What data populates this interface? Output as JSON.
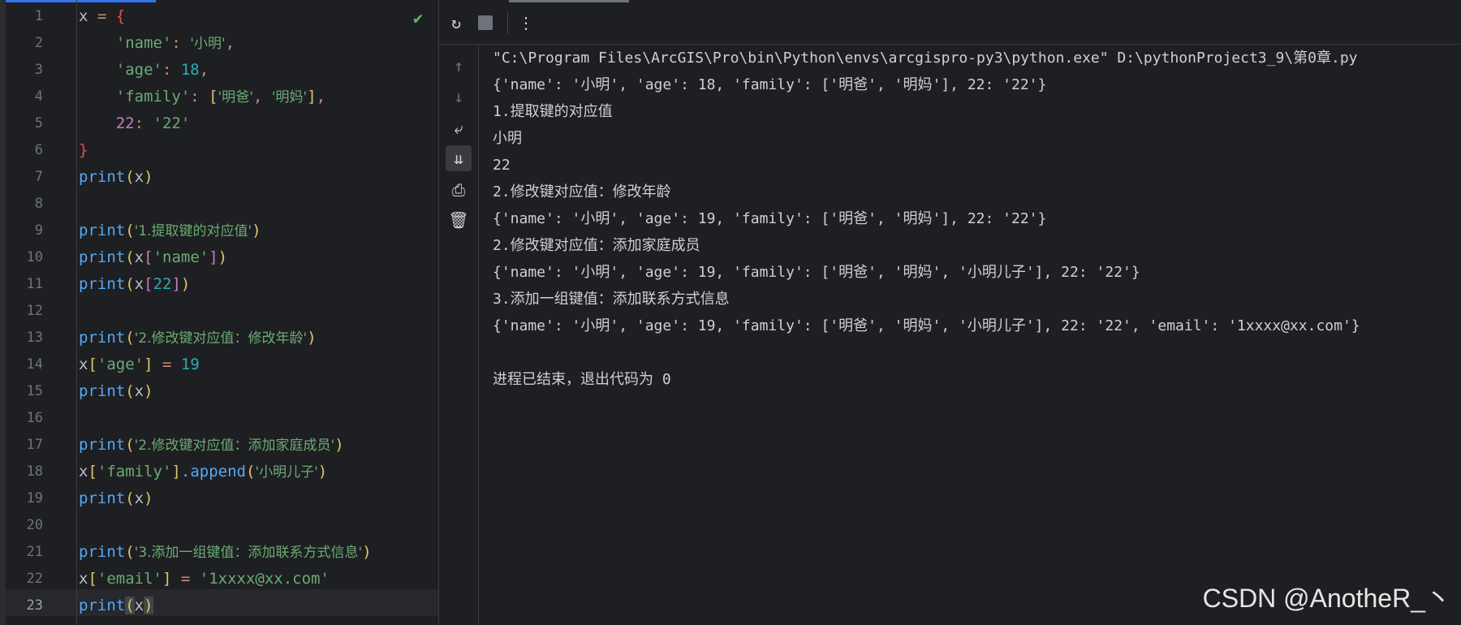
{
  "editor": {
    "line_numbers": [
      "1",
      "2",
      "3",
      "4",
      "5",
      "6",
      "7",
      "8",
      "9",
      "10",
      "11",
      "12",
      "13",
      "14",
      "15",
      "16",
      "17",
      "18",
      "19",
      "20",
      "21",
      "22",
      "23"
    ],
    "inspection_icon": "check-icon",
    "code": {
      "l1_var": "x",
      "l1_eq": " = ",
      "l1_brace": "{",
      "l2_key": "'name'",
      "l2_colon": ": ",
      "l2_val": "'小明'",
      "l2_comma": ",",
      "l3_key": "'age'",
      "l3_colon": ": ",
      "l3_val": "18",
      "l3_comma": ",",
      "l4_key": "'family'",
      "l4_colon": ": ",
      "l4_open": "[",
      "l4_v1": "'明爸'",
      "l4_sep": ", ",
      "l4_v2": "'明妈'",
      "l4_close": "]",
      "l4_comma": ",",
      "l5_key": "22",
      "l5_colon": ": ",
      "l5_val": "'22'",
      "l6_brace": "}",
      "print": "print",
      "l7_arg": "x",
      "l9_arg": "'1.提取键的对应值'",
      "l10_x": "x",
      "l10_key": "'name'",
      "l11_x": "x",
      "l11_key": "22",
      "l13_arg": "'2.修改键对应值：修改年龄'",
      "l14_x": "x",
      "l14_key": "'age'",
      "l14_eq": " = ",
      "l14_val": "19",
      "l15_arg": "x",
      "l17_arg": "'2.修改键对应值：添加家庭成员'",
      "l18_x": "x",
      "l18_key": "'family'",
      "l18_method": ".append",
      "l18_arg": "'小明儿子'",
      "l19_arg": "x",
      "l21_arg": "'3.添加一组键值：添加联系方式信息'",
      "l22_x": "x",
      "l22_key": "'email'",
      "l22_eq": " = ",
      "l22_val": "'1xxxx@xx.com'",
      "l23_arg": "x"
    }
  },
  "run_panel": {
    "toolbar": {
      "rerun_icon": "rerun-icon",
      "stop_icon": "stop-icon",
      "more_icon": "more-vertical-icon"
    },
    "side_toolbar": [
      "arrow-up-icon",
      "arrow-down-icon",
      "soft-wrap-icon",
      "scroll-to-end-icon",
      "print-icon",
      "trash-icon"
    ],
    "output": [
      "\"C:\\Program Files\\ArcGIS\\Pro\\bin\\Python\\envs\\arcgispro-py3\\python.exe\" D:\\pythonProject3_9\\第0章.py",
      "{'name': '小明', 'age': 18, 'family': ['明爸', '明妈'], 22: '22'}",
      "1.提取键的对应值",
      "小明",
      "22",
      "2.修改键对应值：修改年龄",
      "{'name': '小明', 'age': 19, 'family': ['明爸', '明妈'], 22: '22'}",
      "2.修改键对应值：添加家庭成员",
      "{'name': '小明', 'age': 19, 'family': ['明爸', '明妈', '小明儿子'], 22: '22'}",
      "3.添加一组键值：添加联系方式信息",
      "{'name': '小明', 'age': 19, 'family': ['明爸', '明妈', '小明儿子'], 22: '22', 'email': '1xxxx@xx.com'}",
      "",
      "进程已结束，退出代码为 0"
    ]
  },
  "watermark": "CSDN @AnotheR_丶",
  "colors": {
    "background": "#1e1f22",
    "accent": "#3574f0",
    "success": "#5fb865"
  }
}
